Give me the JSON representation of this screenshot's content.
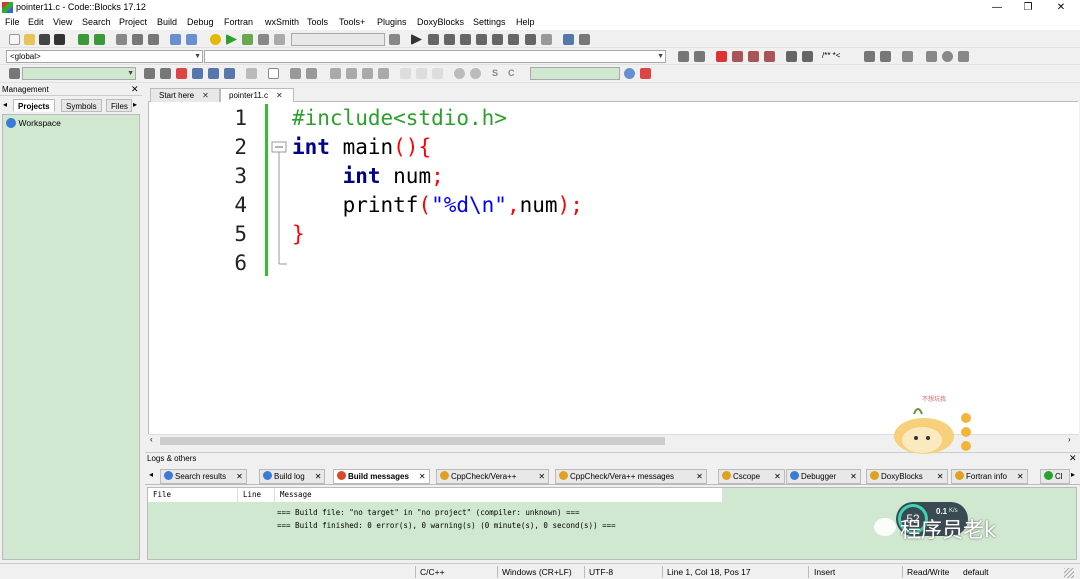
{
  "window": {
    "title": "pointer11.c - Code::Blocks 17.12",
    "controls": [
      "—",
      "❐",
      "✕"
    ]
  },
  "menu": [
    "File",
    "Edit",
    "View",
    "Search",
    "Project",
    "Build",
    "Debug",
    "Fortran",
    "wxSmith",
    "Tools",
    "Tools+",
    "Plugins",
    "DoxyBlocks",
    "Settings",
    "Help"
  ],
  "toolbar": {
    "scope_combo": "<global>",
    "code_completion_combo": "",
    "search_combo": ""
  },
  "management": {
    "title": "Management",
    "tabs": [
      "Projects",
      "Symbols",
      "Files"
    ],
    "active_tab": "Projects",
    "tree": [
      "Workspace"
    ]
  },
  "editor": {
    "tabs": [
      {
        "label": "Start here",
        "active": false
      },
      {
        "label": "pointer11.c",
        "active": true
      }
    ],
    "line_numbers": [
      "1",
      "2",
      "3",
      "4",
      "5",
      "6"
    ],
    "lines": [
      [
        {
          "t": "#include<stdio.h>",
          "c": "pp"
        }
      ],
      [
        {
          "t": "int",
          "c": "kw"
        },
        {
          "t": " main",
          "c": ""
        },
        {
          "t": "(){",
          "c": "op"
        }
      ],
      [
        {
          "t": "    ",
          "c": ""
        },
        {
          "t": "int",
          "c": "kw"
        },
        {
          "t": " num",
          "c": ""
        },
        {
          "t": ";",
          "c": "op"
        }
      ],
      [
        {
          "t": "    printf",
          "c": ""
        },
        {
          "t": "(",
          "c": "op"
        },
        {
          "t": "\"%d\\n\"",
          "c": "str"
        },
        {
          "t": ",",
          "c": "op"
        },
        {
          "t": "num",
          "c": ""
        },
        {
          "t": ");",
          "c": "op"
        }
      ],
      [
        {
          "t": "}",
          "c": "op"
        }
      ],
      []
    ]
  },
  "logs": {
    "title": "Logs & others",
    "tabs": [
      {
        "label": "Search results",
        "active": false,
        "icon": "#3a7bd5"
      },
      {
        "label": "Build log",
        "active": false,
        "icon": "#3a7bd5"
      },
      {
        "label": "Build messages",
        "active": true,
        "icon": "#d94a2a"
      },
      {
        "label": "CppCheck/Vera++",
        "active": false,
        "icon": "#e0a020"
      },
      {
        "label": "CppCheck/Vera++ messages",
        "active": false,
        "icon": "#e0a020"
      },
      {
        "label": "Cscope",
        "active": false,
        "icon": "#e0a020"
      },
      {
        "label": "Debugger",
        "active": false,
        "icon": "#3a7bd5"
      },
      {
        "label": "DoxyBlocks",
        "active": false,
        "icon": "#e0a020"
      },
      {
        "label": "Fortran info",
        "active": false,
        "icon": "#e0a020"
      },
      {
        "label": "Cl",
        "active": false,
        "icon": "#2ca02c"
      }
    ],
    "columns": [
      "File",
      "Line",
      "Message"
    ],
    "messages": [
      "=== Build file: \"no target\" in \"no project\" (compiler: unknown) ===",
      "=== Build finished: 0 error(s), 0 warning(s) (0 minute(s), 0 second(s)) ==="
    ]
  },
  "status": {
    "language": "C/C++",
    "line_endings": "Windows (CR+LF)",
    "encoding": "UTF-8",
    "position": "Line 1, Col 18, Pos 17",
    "mode": "Insert",
    "access": "Read/Write",
    "profile": "default"
  },
  "overlay": {
    "sticker_text": "不想坑我",
    "meter_value": "52",
    "meter_rate": "0.1",
    "meter_unit": "K/s",
    "watermark": "程序员老k"
  }
}
